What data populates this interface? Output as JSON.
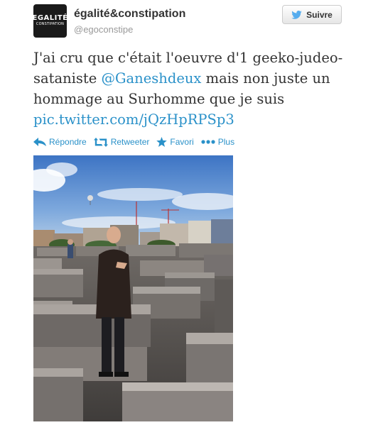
{
  "user": {
    "display_name": "égalité&constipation",
    "handle": "@egoconstipe",
    "avatar_line1": "EGALITÉ",
    "avatar_line2": "CONSTIPATION"
  },
  "follow_button": {
    "label": "Suivre"
  },
  "tweet": {
    "text_before": "J'ai cru que c'était l'oeuvre d'1 geeko-judeo-sataniste ",
    "mention": "@Ganeshdeux",
    "text_after": " mais non juste un hommage au Surhomme que je suis",
    "link": "pic.twitter.com/jQzHpRPSp3"
  },
  "actions": {
    "reply": "Répondre",
    "retweet": "Retweeter",
    "favorite": "Favori",
    "more": "Plus"
  },
  "colors": {
    "link": "#2a91c9",
    "twitter_blue": "#55acee",
    "text": "#333333",
    "muted": "#999999"
  }
}
